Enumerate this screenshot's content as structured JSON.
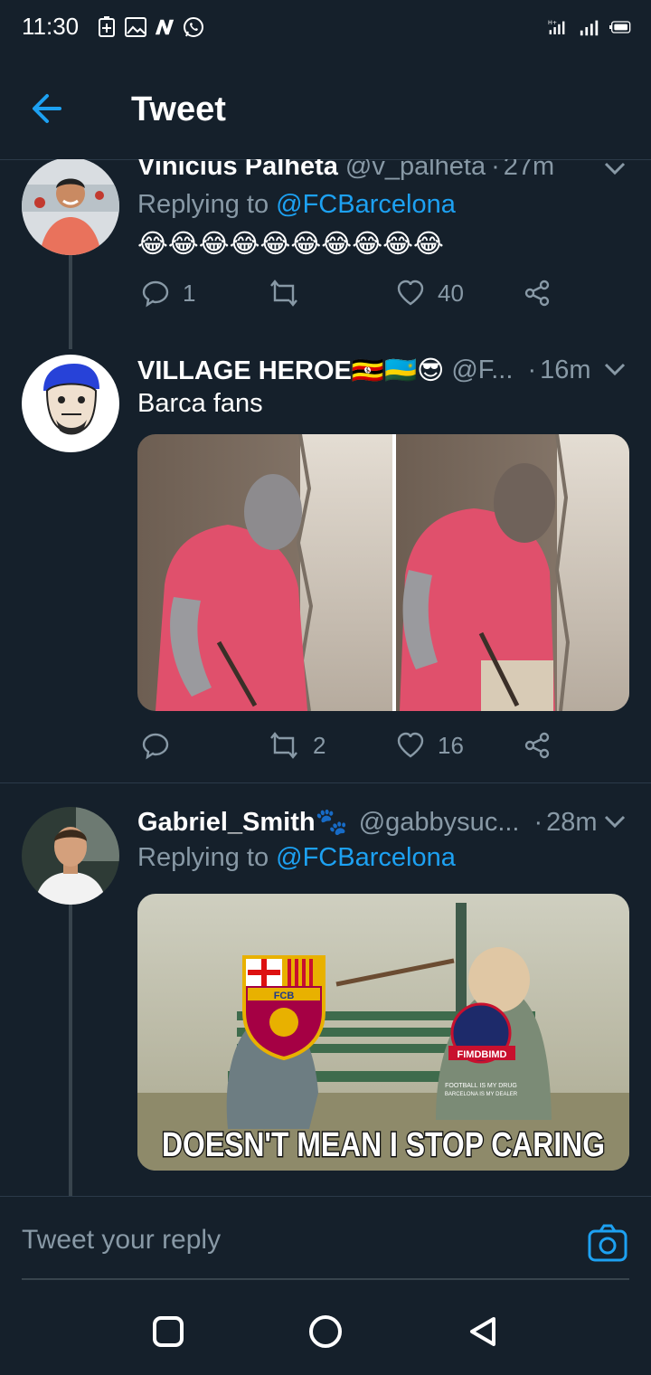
{
  "status_bar": {
    "time": "11:30",
    "left_icons": [
      "battery-saver-icon",
      "gallery-icon",
      "n-app-icon",
      "whatsapp-icon"
    ],
    "right_icons": [
      "signal-icon",
      "signal-icon",
      "battery-icon"
    ]
  },
  "app_bar": {
    "title": "Tweet"
  },
  "tweets": [
    {
      "name": "Vinicius Palheta",
      "handle": "@v_palheta",
      "dot": "·",
      "time": "27m",
      "reply_prefix": "Replying to ",
      "reply_to": "@FCBarcelona",
      "emoji": "😂😂😂😂😂😂😂😂😂😂",
      "reply_count": "1",
      "retweet_count": "",
      "like_count": "40"
    },
    {
      "name": "VILLAGE HEROE🇺🇬🇷🇼😎",
      "handle": "@F...",
      "dot": "·",
      "time": "16m",
      "text": "Barca fans",
      "reply_count": "",
      "retweet_count": "2",
      "like_count": "16"
    },
    {
      "name": "Gabriel_Smith🐾",
      "handle": "@gabbysuc...",
      "dot": "·",
      "time": "28m",
      "reply_prefix": "Replying to ",
      "reply_to": "@FCBarcelona",
      "meme": {
        "crest_text": "FCB",
        "badge_text": "FIMDBIMD",
        "small_text_1": "FOOTBALL IS MY DRUG",
        "small_text_2": "BARCELONA IS MY DEALER",
        "caption": "DOESN'T MEAN I STOP CARING"
      }
    }
  ],
  "reply_bar": {
    "placeholder": "Tweet your reply"
  },
  "colors": {
    "background": "#15202b",
    "accent": "#1da1f2",
    "muted": "#8899a6",
    "divider": "#2b3a49"
  }
}
